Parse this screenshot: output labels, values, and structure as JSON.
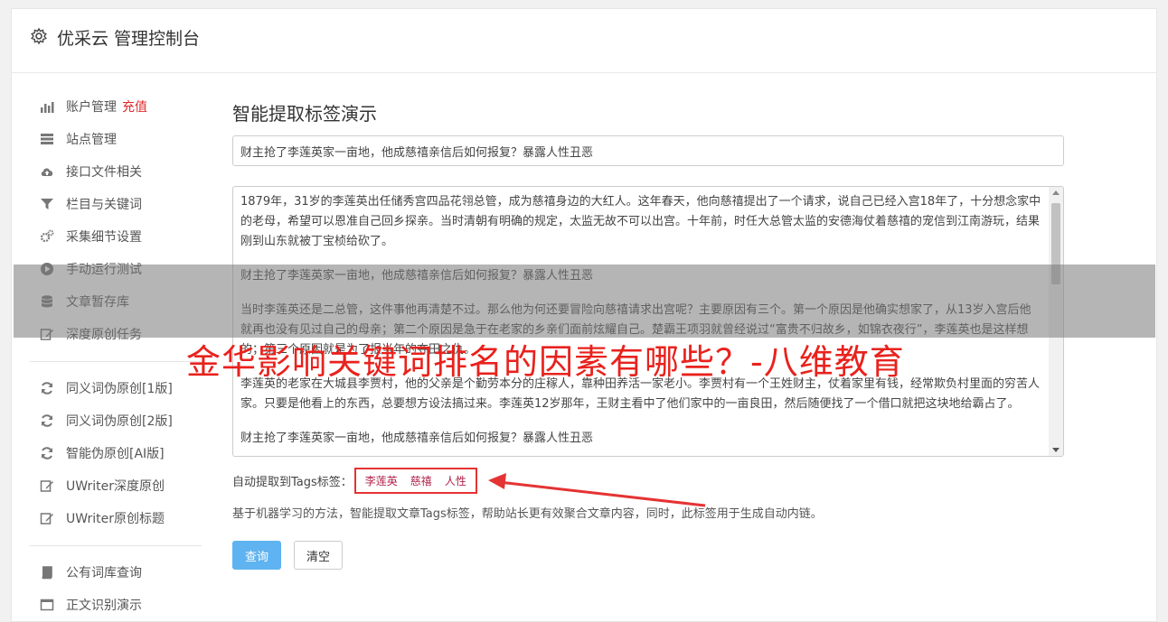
{
  "header": {
    "title": "优采云 管理控制台"
  },
  "sidebar": {
    "group1": [
      {
        "label": "账户管理",
        "badge": "充值",
        "icon": "bar-chart-icon"
      },
      {
        "label": "站点管理",
        "icon": "server-icon"
      },
      {
        "label": "接口文件相关",
        "icon": "cloud-upload-icon"
      },
      {
        "label": "栏目与关键词",
        "icon": "filter-icon"
      },
      {
        "label": "采集细节设置",
        "icon": "gears-icon"
      },
      {
        "label": "手动运行测试",
        "icon": "play-circle-icon"
      },
      {
        "label": "文章暂存库",
        "icon": "database-icon"
      },
      {
        "label": "深度原创任务",
        "icon": "edit-icon"
      }
    ],
    "group2": [
      {
        "label": "同义词伪原创[1版]",
        "icon": "refresh-icon"
      },
      {
        "label": "同义词伪原创[2版]",
        "icon": "refresh-icon"
      },
      {
        "label": "智能伪原创[AI版]",
        "icon": "refresh-icon"
      },
      {
        "label": "UWriter深度原创",
        "icon": "edit-icon"
      },
      {
        "label": "UWriter原创标题",
        "icon": "edit-icon"
      }
    ],
    "group3": [
      {
        "label": "公有词库查询",
        "icon": "book-icon"
      },
      {
        "label": "正文识别演示",
        "icon": "window-icon"
      }
    ]
  },
  "main": {
    "heading": "智能提取标签演示",
    "title_value": "财主抢了李莲英家一亩地，他成慈禧亲信后如何报复？暴露人性丑恶",
    "paragraphs": [
      "1879年，31岁的李莲英出任储秀宫四品花翎总管，成为慈禧身边的大红人。这年春天，他向慈禧提出了一个请求，说自己已经入宫18年了，十分想念家中的老母，希望可以恩准自己回乡探亲。当时清朝有明确的规定，太监无故不可以出宫。十年前，时任大总管太监的安德海仗着慈禧的宠信到江南游玩，结果刚到山东就被丁宝桢给砍了。",
      "财主抢了李莲英家一亩地，他成慈禧亲信后如何报复？暴露人性丑恶",
      "当时李莲英还是二总管，这件事他再清楚不过。那么他为何还要冒险向慈禧请求出宫呢？主要原因有三个。第一个原因是他确实想家了，从13岁入宫后他就再也没有见过自己的母亲；第二个原因是急于在老家的乡亲们面前炫耀自己。楚霸王项羽就曾经说过“富贵不归故乡，如锦衣夜行”，李莲英也是这样想的；第三个原因就是为了报当年的夺田之仇。",
      "李莲英的老家在大城县李贾村，他的父亲是个勤劳本分的庄稼人，靠种田养活一家老小。李贾村有一个王姓财主，仗着家里有钱，经常欺负村里面的穷苦人家。只要是他看上的东西，总要想方设法搞过来。李莲英12岁那年，王财主看中了他们家中的一亩良田，然后随便找了一个借口就把这块地给霸占了。",
      "财主抢了李莲英家一亩地，他成慈禧亲信后如何报复？暴露人性丑恶"
    ],
    "tags_label": "自动提取到Tags标签：",
    "tags": [
      "李莲英",
      "慈禧",
      "人性"
    ],
    "description": "基于机器学习的方法，智能提取文章Tags标签，帮助站长更有效聚合文章内容，同时，此标签用于生成自动内链。",
    "query_button": "查询",
    "clear_button": "清空"
  },
  "overlay": {
    "text": "金华影响关键词排名的因素有哪些？-八维教育"
  },
  "colors": {
    "accent": "#5fb3f0",
    "highlight": "#e02b2b",
    "overlay_text": "#e8221d",
    "tag": "#b0234a"
  }
}
